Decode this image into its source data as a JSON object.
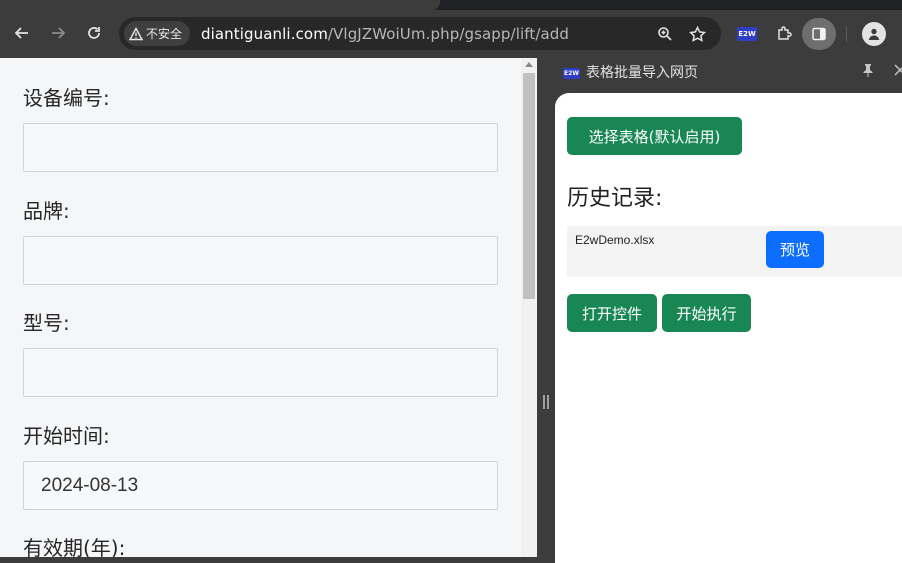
{
  "browser": {
    "security_chip": "不安全",
    "url_domain": "diantiguanli.com",
    "url_path": "/VlgJZWoiUm.php/gsapp/lift/add",
    "extension_badge": "E2W"
  },
  "form": {
    "fields": [
      {
        "label": "设备编号:",
        "value": ""
      },
      {
        "label": "品牌:",
        "value": ""
      },
      {
        "label": "型号:",
        "value": ""
      },
      {
        "label": "开始时间:",
        "value": "2024-08-13"
      },
      {
        "label": "有效期(年):",
        "value": ""
      }
    ]
  },
  "side_panel": {
    "logo": "E2W",
    "title": "表格批量导入网页",
    "select_button": "选择表格(默认启用)",
    "history_title": "历史记录:",
    "history": [
      {
        "file": "E2wDemo.xlsx",
        "preview_button": "预览"
      }
    ],
    "open_controls_button": "打开控件",
    "start_button": "开始执行"
  },
  "colors": {
    "primary_green": "#198754",
    "primary_blue": "#0d6efd",
    "toolbar_bg": "#3c3c3c"
  }
}
